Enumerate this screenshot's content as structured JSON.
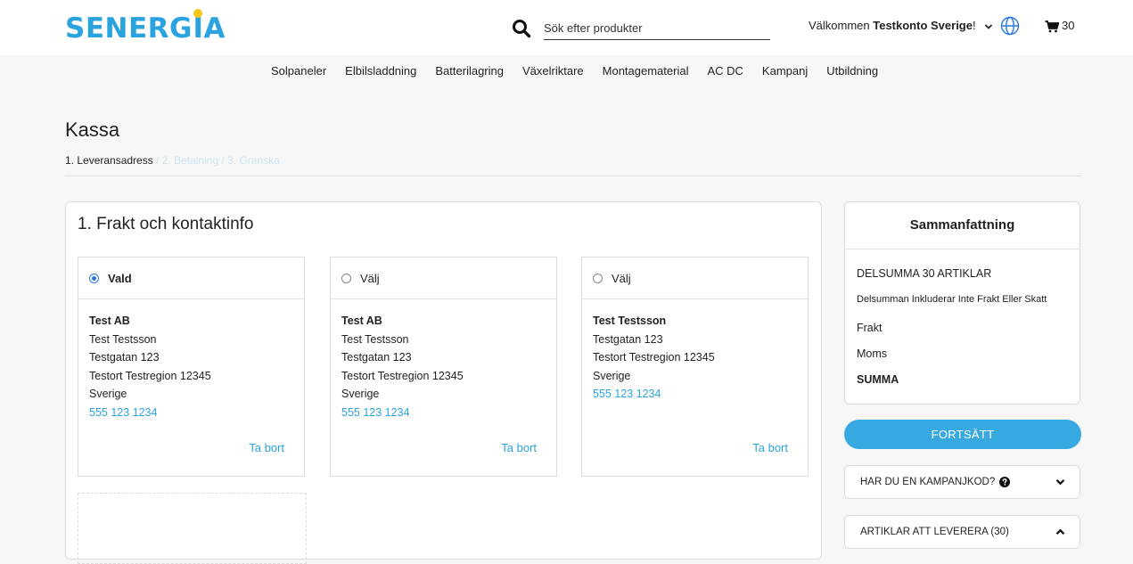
{
  "brand": {
    "logo_text_before": "SENERG",
    "logo_text_i": "i",
    "logo_text_after": "A",
    "primary_color": "#2aa3df",
    "sun_color": "#f5c61b"
  },
  "header": {
    "search_placeholder": "Sök efter produkter",
    "welcome_prefix": "Välkommen ",
    "account_name": "Testkonto Sverige",
    "welcome_suffix": "!",
    "cart_count": "30"
  },
  "nav": {
    "items": [
      "Solpaneler",
      "Elbilsladdning",
      "Batterilagring",
      "Växelriktare",
      "Montagematerial",
      "AC DC",
      "Kampanj",
      "Utbildning"
    ]
  },
  "page": {
    "title": "Kassa",
    "steps": {
      "active": "1. Leveransadress",
      "rest": " / 2. Betalning / 3. Granska"
    }
  },
  "shipping": {
    "section_title": "1. Frakt och kontaktinfo",
    "remove_label": "Ta bort",
    "addresses": [
      {
        "selection_label": "Vald",
        "selected": true,
        "company": "Test AB",
        "person": "Test Testsson",
        "street": "Testgatan 123",
        "city_line": "Testort Testregion 12345",
        "country": "Sverige",
        "phone": "555 123 1234"
      },
      {
        "selection_label": "Välj",
        "selected": false,
        "company": "Test AB",
        "person": "Test Testsson",
        "street": "Testgatan 123",
        "city_line": "Testort Testregion 12345",
        "country": "Sverige",
        "phone": "555 123 1234"
      },
      {
        "selection_label": "Välj",
        "selected": false,
        "company": "Test Testsson",
        "street": "Testgatan 123",
        "city_line": "Testort Testregion 12345",
        "country": "Sverige",
        "phone": "555 123 1234"
      }
    ]
  },
  "summary": {
    "title": "Sammanfattning",
    "subtotal_label": "DELSUMMA 30 ARTIKLAR",
    "subtotal_note": "Delsumman Inkluderar Inte Frakt Eller Skatt",
    "shipping_label": "Frakt",
    "tax_label": "Moms",
    "total_label": "SUMMA",
    "continue_label": "FORTSÄTT",
    "coupon_label": "HAR DU EN KAMPANJKOD?",
    "items_label": "ARTIKLAR ATT LEVERERA (30)"
  }
}
